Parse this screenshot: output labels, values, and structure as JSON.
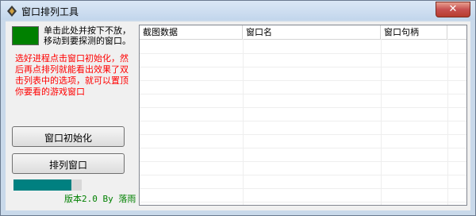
{
  "window": {
    "title": "窗口排列工具",
    "close_glyph": "✕",
    "icon": "app-icon"
  },
  "left": {
    "hint_black": "单击此处并按下不放，移动到要探测的窗口。",
    "hint_red": "选好进程点击窗口初始化，然后再点排列就能看出效果了双击列表中的选项，就可以置顶你要看的游戏窗口",
    "init_button": "窗口初始化",
    "arrange_button": "排列窗口",
    "progress": 0.85,
    "version": "版本2.0 By 落雨"
  },
  "list": {
    "columns": [
      "截图数据",
      "窗口名",
      "窗口句柄"
    ],
    "rows": []
  },
  "colors": {
    "target": "#008000",
    "hint_red": "#ff0000",
    "progress": "#008080",
    "version": "#008000"
  }
}
